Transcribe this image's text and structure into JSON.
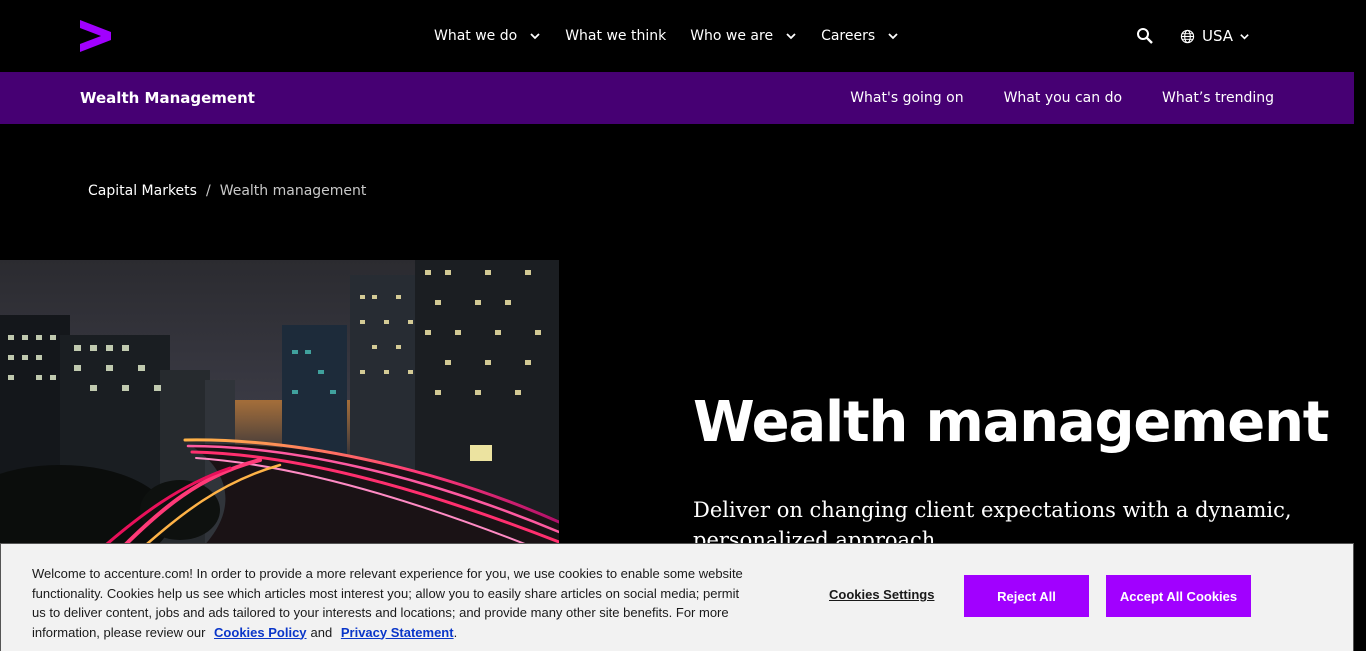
{
  "colors": {
    "brand_purple": "#a100ff",
    "subnav_purple": "#460073",
    "background": "#000000",
    "cookie_bg": "#f2f2f2",
    "link_blue": "#0a36c9"
  },
  "header": {
    "logo_icon": "accenture-greater-than-logo",
    "nav": [
      {
        "label": "What we do",
        "has_dropdown": true
      },
      {
        "label": "What we think",
        "has_dropdown": false
      },
      {
        "label": "Who we are",
        "has_dropdown": true
      },
      {
        "label": "Careers",
        "has_dropdown": true
      }
    ],
    "search_icon": "search-icon",
    "country": "USA"
  },
  "subnav": {
    "title": "Wealth Management",
    "links": [
      "What's going on",
      "What you can do",
      "What’s trending"
    ]
  },
  "breadcrumb": {
    "parent": "Capital Markets",
    "separator": "/",
    "current": "Wealth management"
  },
  "hero": {
    "image_alt": "night-city-highway-light-trails",
    "title": "Wealth management",
    "subtitle": "Deliver on changing client expectations with a dynamic, personalized approach"
  },
  "cookie_banner": {
    "text": "Welcome to accenture.com! In order to provide a more relevant experience for you, we use cookies to enable some website functionality. Cookies help us see which articles most interest you; allow you to easily share articles on social media; permit us to deliver content, jobs and ads tailored to your interests and locations; and provide many other site benefits. For more information, please review our",
    "policy_link": "Cookies Policy",
    "and": "and",
    "privacy_link": "Privacy Statement",
    "period": ".",
    "settings_label": "Cookies Settings",
    "reject_label": "Reject All",
    "accept_label": "Accept All Cookies"
  }
}
